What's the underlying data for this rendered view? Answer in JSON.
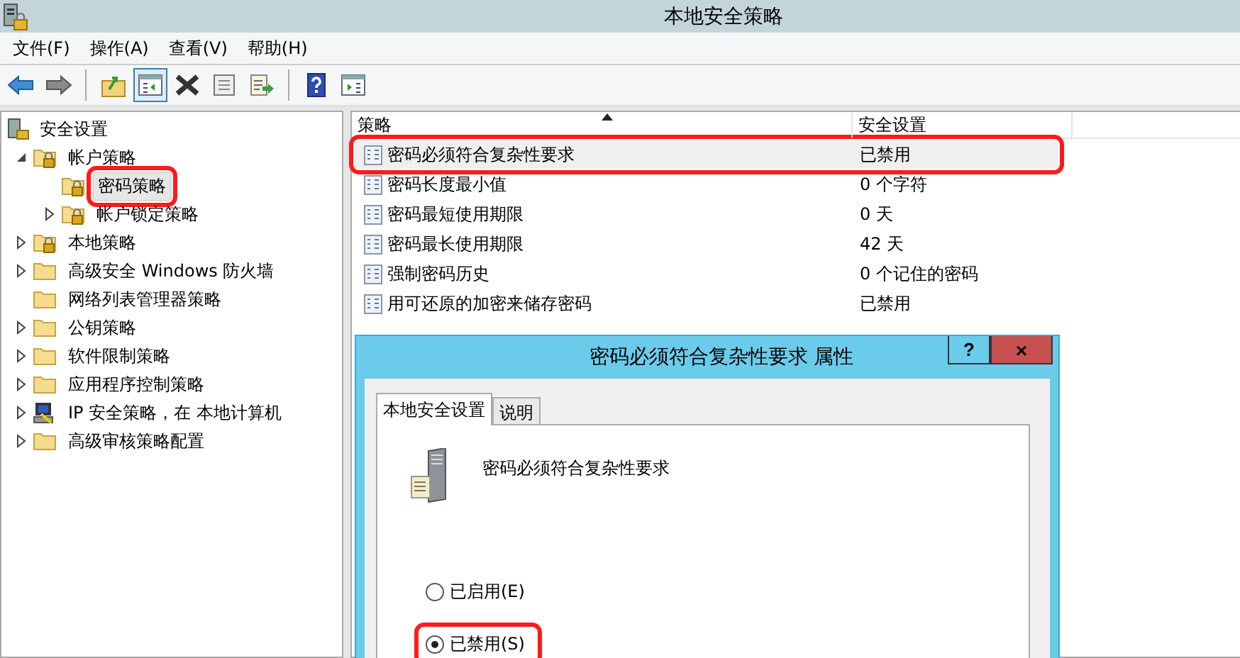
{
  "window": {
    "title": "本地安全策略"
  },
  "menu": [
    "文件(F)",
    "操作(A)",
    "查看(V)",
    "帮助(H)"
  ],
  "toolbar": [
    {
      "kind": "back",
      "pressed": false
    },
    {
      "kind": "forward",
      "pressed": false
    },
    {
      "kind": "separator"
    },
    {
      "kind": "up",
      "pressed": false
    },
    {
      "kind": "tree",
      "pressed": true
    },
    {
      "kind": "delete",
      "pressed": false
    },
    {
      "kind": "properties",
      "pressed": false
    },
    {
      "kind": "export",
      "pressed": false
    },
    {
      "kind": "separator"
    },
    {
      "kind": "help",
      "pressed": false
    },
    {
      "kind": "pane",
      "pressed": false
    }
  ],
  "tree": {
    "root": {
      "label": "安全设置"
    },
    "children": [
      {
        "label": "帐户策略",
        "kind": "locked",
        "expandable": true,
        "expanded": true,
        "selected": false,
        "highlighted": false,
        "children": [
          {
            "label": "密码策略",
            "kind": "locked",
            "expandable": false,
            "expanded": false,
            "selected": true,
            "highlighted": true
          },
          {
            "label": "帐户锁定策略",
            "kind": "locked",
            "expandable": true,
            "expanded": false,
            "selected": false,
            "highlighted": false
          }
        ]
      },
      {
        "label": "本地策略",
        "kind": "locked",
        "expandable": true,
        "expanded": false,
        "selected": false,
        "highlighted": false
      },
      {
        "label": "高级安全 Windows 防火墙",
        "kind": "folder",
        "expandable": true,
        "expanded": false,
        "selected": false,
        "highlighted": false
      },
      {
        "label": "网络列表管理器策略",
        "kind": "folder",
        "expandable": false,
        "expanded": false,
        "selected": false,
        "highlighted": false
      },
      {
        "label": "公钥策略",
        "kind": "folder",
        "expandable": true,
        "expanded": false,
        "selected": false,
        "highlighted": false
      },
      {
        "label": "软件限制策略",
        "kind": "folder",
        "expandable": true,
        "expanded": false,
        "selected": false,
        "highlighted": false
      },
      {
        "label": "应用程序控制策略",
        "kind": "folder",
        "expandable": true,
        "expanded": false,
        "selected": false,
        "highlighted": false
      },
      {
        "label": "IP 安全策略，在 本地计算机",
        "kind": "computer",
        "expandable": true,
        "expanded": false,
        "selected": false,
        "highlighted": false
      },
      {
        "label": "高级审核策略配置",
        "kind": "folder",
        "expandable": true,
        "expanded": false,
        "selected": false,
        "highlighted": false
      }
    ]
  },
  "table": {
    "columns": [
      {
        "label": "策略",
        "sorted": true
      },
      {
        "label": "安全设置",
        "sorted": false
      }
    ],
    "rows": [
      {
        "policy": "密码必须符合复杂性要求",
        "setting": "已禁用",
        "selected": true,
        "highlighted": true
      },
      {
        "policy": "密码长度最小值",
        "setting": "0 个字符",
        "selected": false,
        "highlighted": false
      },
      {
        "policy": "密码最短使用期限",
        "setting": "0 天",
        "selected": false,
        "highlighted": false
      },
      {
        "policy": "密码最长使用期限",
        "setting": "42 天",
        "selected": false,
        "highlighted": false
      },
      {
        "policy": "强制密码历史",
        "setting": "0 个记住的密码",
        "selected": false,
        "highlighted": false
      },
      {
        "policy": "用可还原的加密来储存密码",
        "setting": "已禁用",
        "selected": false,
        "highlighted": false
      }
    ]
  },
  "dialog": {
    "title": "密码必须符合复杂性要求 属性",
    "help": "?",
    "close": "×",
    "tabs": [
      {
        "label": "本地安全设置",
        "selected": true
      },
      {
        "label": "说明",
        "selected": false
      }
    ],
    "policy_name": "密码必须符合复杂性要求",
    "options": [
      {
        "label": "已启用(E)",
        "selected": false,
        "highlighted": false
      },
      {
        "label": "已禁用(S)",
        "selected": true,
        "highlighted": true
      }
    ]
  }
}
